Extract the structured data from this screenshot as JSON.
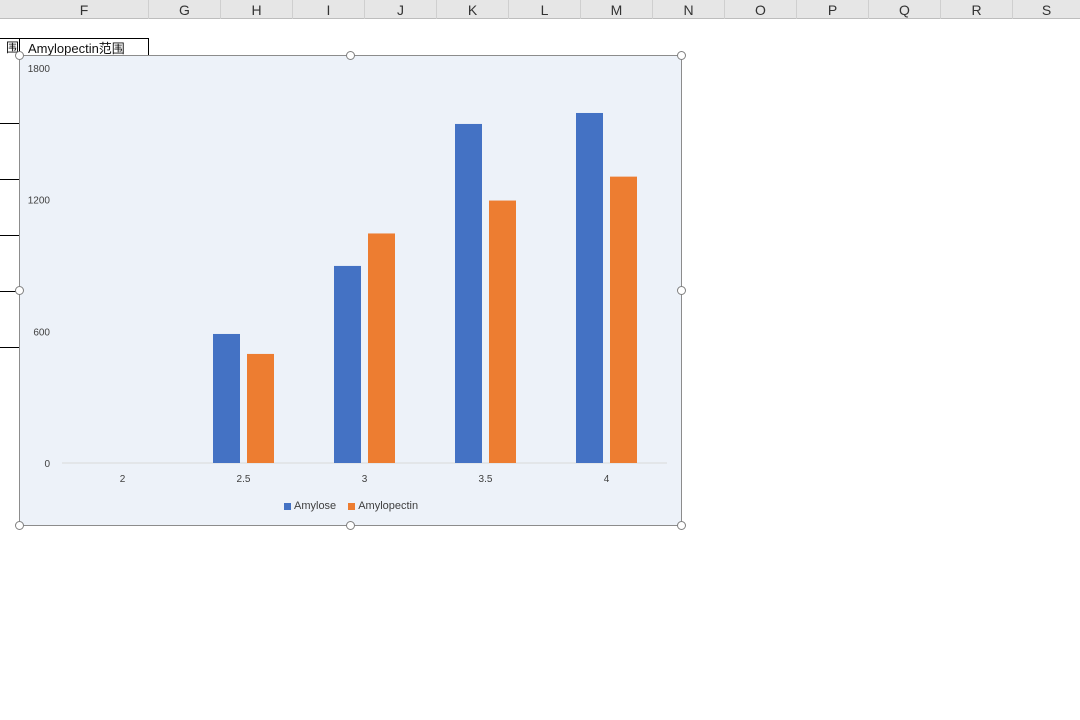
{
  "sheet": {
    "columns": [
      "F",
      "G",
      "H",
      "I",
      "J",
      "K",
      "L",
      "M",
      "N",
      "O",
      "P",
      "Q",
      "R",
      "S"
    ],
    "cells": {
      "left_fragment": "围",
      "header_text": "Amylopectin范围"
    }
  },
  "chart_data": {
    "type": "bar",
    "title": "",
    "xlabel": "",
    "ylabel": "",
    "categories": [
      "2",
      "2.5",
      "3",
      "3.5",
      "4"
    ],
    "series": [
      {
        "name": "Amylose",
        "color": "#4472c4",
        "values": [
          0,
          588,
          898,
          1545,
          1595
        ]
      },
      {
        "name": "Amylopectin",
        "color": "#ed7d31",
        "values": [
          0,
          497,
          1046,
          1196,
          1305
        ]
      }
    ],
    "ylim": [
      0,
      1800
    ],
    "yticks": [
      0,
      600,
      1200,
      1800
    ],
    "grid": false,
    "legend_position": "bottom"
  },
  "legend": {
    "items": [
      {
        "label": "Amylose",
        "color": "#4472c4"
      },
      {
        "label": "Amylopectin",
        "color": "#ed7d31"
      }
    ]
  }
}
